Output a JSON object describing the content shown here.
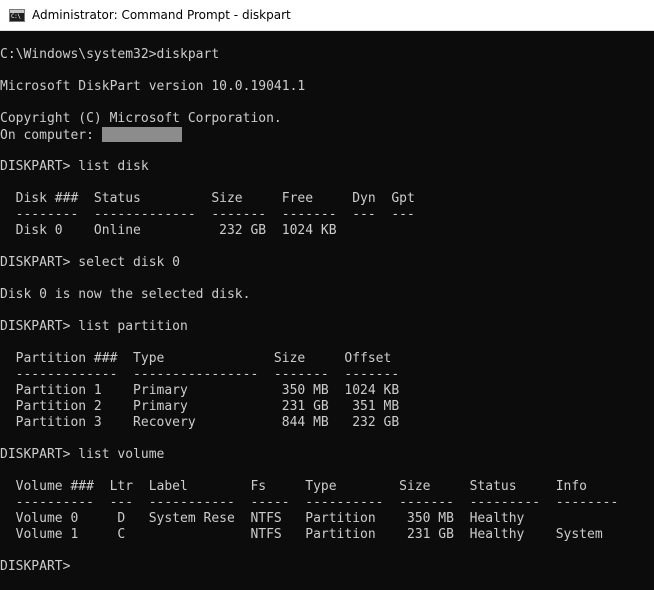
{
  "window": {
    "title": "Administrator: Command Prompt - diskpart",
    "icon": "cmd-icon",
    "icon_text": "C:\\"
  },
  "console": {
    "prompt_cwd": "C:\\Windows\\system32>diskpart",
    "version": "Microsoft DiskPart version 10.0.19041.1",
    "copyright": "Copyright (C) Microsoft Corporation.",
    "computer_label": "On computer: ",
    "cmd_list_disk": "DISKPART> list disk",
    "disk_header": "  Disk ###  Status         Size     Free     Dyn  Gpt",
    "disk_sep": "  --------  -------------  -------  -------  ---  ---",
    "disk_rows": [
      "  Disk 0    Online          232 GB  1024 KB"
    ],
    "cmd_select_disk": "DISKPART> select disk 0",
    "select_result": "Disk 0 is now the selected disk.",
    "cmd_list_partition": "DISKPART> list partition",
    "partition_header": "  Partition ###  Type              Size     Offset",
    "partition_sep": "  -------------  ----------------  -------  -------",
    "partition_rows": [
      "  Partition 1    Primary            350 MB  1024 KB",
      "  Partition 2    Primary            231 GB   351 MB",
      "  Partition 3    Recovery           844 MB   232 GB"
    ],
    "cmd_list_volume": "DISKPART> list volume",
    "volume_header": "  Volume ###  Ltr  Label        Fs     Type        Size     Status     Info",
    "volume_sep": "  ----------  ---  -----------  -----  ----------  -------  ---------  --------",
    "volume_rows": [
      "  Volume 0     D   System Rese  NTFS   Partition    350 MB  Healthy",
      "  Volume 1     C                NTFS   Partition    231 GB  Healthy    System"
    ],
    "final_prompt": "DISKPART>"
  }
}
